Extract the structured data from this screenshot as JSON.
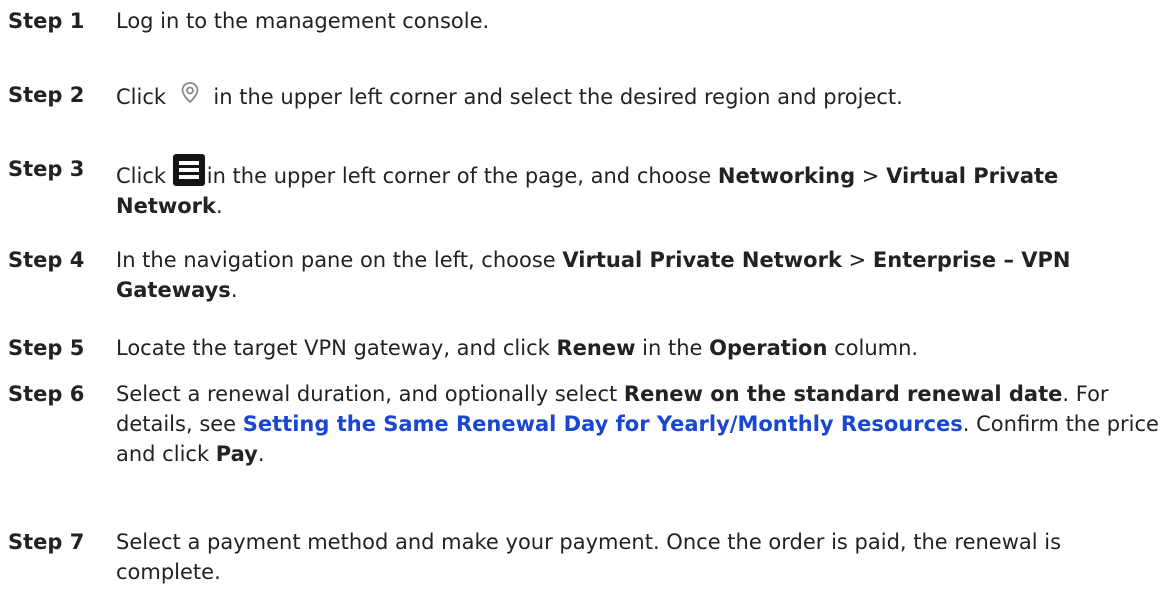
{
  "steps": [
    {
      "label": "Step 1",
      "text": [
        "Log in to the management console."
      ]
    },
    {
      "label": "Step 2",
      "text": [
        "Click",
        "in the upper left corner and select the desired region and project."
      ],
      "icon": "location-pin-icon"
    },
    {
      "label": "Step 3",
      "text": [
        "Click",
        "in the upper left corner of the page, and choose",
        "Networking",
        ">",
        "Virtual Private Network",
        "."
      ],
      "icon": "menu-icon"
    },
    {
      "label": "Step 4",
      "text": [
        "In the navigation pane on the left, choose",
        "Virtual Private Network",
        ">",
        "Enterprise – VPN Gateways",
        "."
      ]
    },
    {
      "label": "Step 5",
      "text": [
        "Locate the target VPN gateway, and click",
        "Renew",
        "in the",
        "Operation",
        "column."
      ]
    },
    {
      "label": "Step 6",
      "text": [
        "Select a renewal duration, and optionally select",
        "Renew on the standard renewal date",
        ". For details, see",
        "Setting the Same Renewal Day for Yearly/Monthly Resources",
        ". Confirm the price and click",
        "Pay",
        "."
      ]
    },
    {
      "label": "Step 7",
      "text": [
        "Select a payment method and make your payment. Once the order is paid, the renewal is complete."
      ]
    }
  ],
  "colors": {
    "link": "#1a47d1",
    "text": "#222222"
  }
}
